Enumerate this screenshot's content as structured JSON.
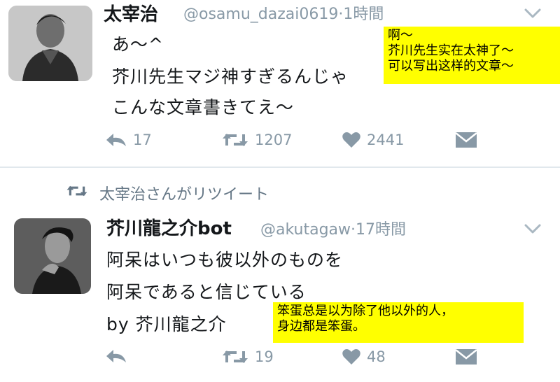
{
  "tweets": [
    {
      "author": "太宰治",
      "handle": "@osamu_dazai0619",
      "separator": "·",
      "time": "1時間",
      "lines": [
        "あ〜^",
        "芥川先生マジ神すぎるんじゃ",
        "こんな文章書きてえ〜"
      ],
      "actions": {
        "replies": "17",
        "retweets": "1207",
        "likes": "2441"
      }
    },
    {
      "retweeted_by": "太宰治さんがリツイート",
      "author": "芥川龍之介bot",
      "handle": "@akutagaw",
      "separator": "·",
      "time": "17時間",
      "lines": [
        "阿呆はいつも彼以外のものを",
        "阿呆であると信じている",
        "by 芥川龍之介"
      ],
      "actions": {
        "replies": "",
        "retweets": "19",
        "likes": "48"
      }
    }
  ],
  "annotations": [
    {
      "lines": [
        "啊〜",
        "芥川先生实在太神了〜",
        "可以写出这样的文章〜"
      ]
    },
    {
      "lines": [
        "笨蛋总是以为除了他以外的人，",
        "身边都是笨蛋。"
      ]
    }
  ],
  "colors": {
    "text": "#14171a",
    "muted": "#8899a6",
    "annotation_bg": "#ffff00",
    "divider": "#e1e8ed"
  },
  "icons": [
    "reply-icon",
    "retweet-icon",
    "heart-icon",
    "direct-message-icon",
    "chevron-down-icon"
  ]
}
